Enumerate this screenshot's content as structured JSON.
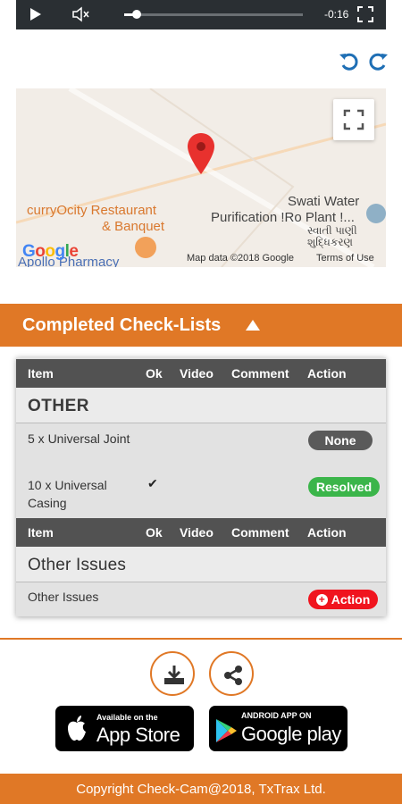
{
  "video": {
    "time": "-0:16",
    "progress": 0.07
  },
  "map": {
    "labels": {
      "restaurant": [
        "curryOcity Restaurant",
        "& Banquet"
      ],
      "water": [
        "Swati Water",
        "Purification !Ro Plant !..."
      ],
      "gujarati": [
        "સ્વાતી પાણી",
        "શુદ્ધિકરણ"
      ],
      "pharmacy": "Apollo Pharmacy"
    },
    "logo": "Google",
    "map_data": "Map data ©2018 Google",
    "terms": "Terms of Use"
  },
  "section": {
    "title": "Completed Check-Lists"
  },
  "table": {
    "columns": [
      "Item",
      "Ok",
      "Video",
      "Comment",
      "Action"
    ],
    "groups": [
      {
        "title": "OTHER",
        "rows": [
          {
            "item": "5 x Universal Joint",
            "ok": "",
            "action": "None"
          },
          {
            "item": "10 x Universal Casing",
            "ok": "✔",
            "action": "Resolved"
          }
        ]
      },
      {
        "title": "Other Issues",
        "rows": [
          {
            "item": "Other Issues",
            "ok": "",
            "action": "Action"
          }
        ]
      }
    ]
  },
  "stores": {
    "apple": {
      "small": "Available on the",
      "big": "App Store"
    },
    "google": {
      "small": "ANDROID APP ON",
      "big": "Google play"
    }
  },
  "footer": "Copyright Check-Cam@2018, TxTrax Ltd.",
  "colors": {
    "accent": "#e07826",
    "header": "#525252",
    "resolved": "#3bb54a",
    "action": "#f0141e",
    "none": "#5a5a5a"
  }
}
